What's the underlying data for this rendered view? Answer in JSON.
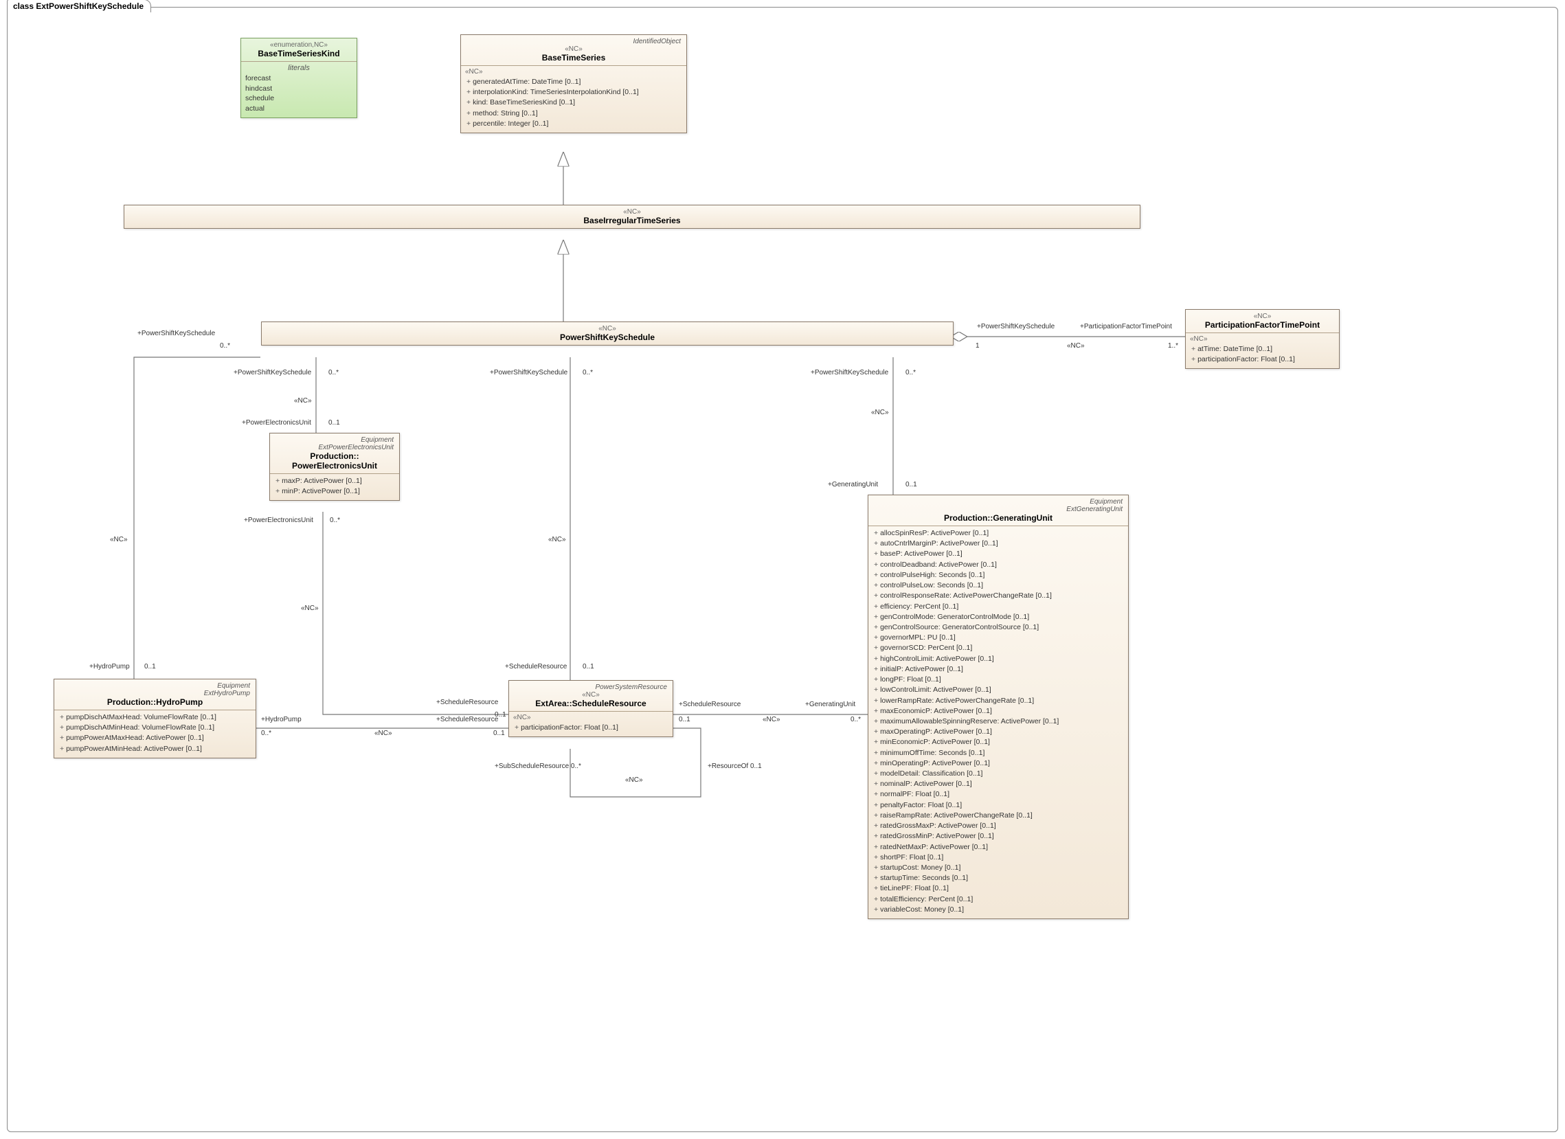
{
  "frame": {
    "title_prefix": "class",
    "title": "ExtPowerShiftKeySchedule"
  },
  "enum_BaseTimeSeriesKind": {
    "stereo": "«enumeration,NC»",
    "name": "BaseTimeSeriesKind",
    "literals_label": "literals",
    "l0": "forecast",
    "l1": "hindcast",
    "l2": "schedule",
    "l3": "actual"
  },
  "BaseTimeSeries": {
    "parent": "IdentifiedObject",
    "stereo": "«NC»",
    "name": "BaseTimeSeries",
    "sec_stereo": "«NC»",
    "a0": "generatedAtTime: DateTime [0..1]",
    "a1": "interpolationKind: TimeSeriesInterpolationKind [0..1]",
    "a2": "kind: BaseTimeSeriesKind [0..1]",
    "a3": "method: String [0..1]",
    "a4": "percentile: Integer [0..1]"
  },
  "BaseIrregularTimeSeries": {
    "stereo": "«NC»",
    "name": "BaseIrregularTimeSeries"
  },
  "PowerShiftKeySchedule": {
    "stereo": "«NC»",
    "name": "PowerShiftKeySchedule"
  },
  "ParticipationFactorTimePoint": {
    "stereo": "«NC»",
    "name": "ParticipationFactorTimePoint",
    "sec_stereo": "«NC»",
    "a0": "atTime: DateTime [0..1]",
    "a1": "participationFactor: Float [0..1]"
  },
  "PowerElectronicsUnit": {
    "parent1": "Equipment",
    "parent2": "ExtPowerElectronicsUnit",
    "stereo": "Production::",
    "name": "PowerElectronicsUnit",
    "a0": "maxP: ActivePower [0..1]",
    "a1": "minP: ActivePower [0..1]"
  },
  "HydroPump": {
    "parent1": "Equipment",
    "parent2": "ExtHydroPump",
    "stereo": "Production::",
    "name": "HydroPump",
    "a0": "pumpDischAtMaxHead: VolumeFlowRate [0..1]",
    "a1": "pumpDischAtMinHead: VolumeFlowRate [0..1]",
    "a2": "pumpPowerAtMaxHead: ActivePower [0..1]",
    "a3": "pumpPowerAtMinHead: ActivePower [0..1]"
  },
  "ScheduleResource": {
    "parent": "PowerSystemResource",
    "stereo": "«NC»",
    "qname_prefix": "ExtArea::",
    "name": "ScheduleResource",
    "sec_stereo": "«NC»",
    "a0": "participationFactor: Float [0..1]"
  },
  "GeneratingUnit": {
    "parent1": "Equipment",
    "parent2": "ExtGeneratingUnit",
    "qname_prefix": "Production::",
    "name": "GeneratingUnit",
    "a0": "allocSpinResP: ActivePower [0..1]",
    "a1": "autoCntrlMarginP: ActivePower [0..1]",
    "a2": "baseP: ActivePower [0..1]",
    "a3": "controlDeadband: ActivePower [0..1]",
    "a4": "controlPulseHigh: Seconds [0..1]",
    "a5": "controlPulseLow: Seconds [0..1]",
    "a6": "controlResponseRate: ActivePowerChangeRate [0..1]",
    "a7": "efficiency: PerCent [0..1]",
    "a8": "genControlMode: GeneratorControlMode [0..1]",
    "a9": "genControlSource: GeneratorControlSource [0..1]",
    "a10": "governorMPL: PU [0..1]",
    "a11": "governorSCD: PerCent [0..1]",
    "a12": "highControlLimit: ActivePower [0..1]",
    "a13": "initialP: ActivePower [0..1]",
    "a14": "longPF: Float [0..1]",
    "a15": "lowControlLimit: ActivePower [0..1]",
    "a16": "lowerRampRate: ActivePowerChangeRate [0..1]",
    "a17": "maxEconomicP: ActivePower [0..1]",
    "a18": "maximumAllowableSpinningReserve: ActivePower [0..1]",
    "a19": "maxOperatingP: ActivePower [0..1]",
    "a20": "minEconomicP: ActivePower [0..1]",
    "a21": "minimumOffTime: Seconds [0..1]",
    "a22": "minOperatingP: ActivePower [0..1]",
    "a23": "modelDetail: Classification [0..1]",
    "a24": "nominalP: ActivePower [0..1]",
    "a25": "normalPF: Float [0..1]",
    "a26": "penaltyFactor: Float [0..1]",
    "a27": "raiseRampRate: ActivePowerChangeRate [0..1]",
    "a28": "ratedGrossMaxP: ActivePower [0..1]",
    "a29": "ratedGrossMinP: ActivePower [0..1]",
    "a30": "ratedNetMaxP: ActivePower [0..1]",
    "a31": "shortPF: Float [0..1]",
    "a32": "startupCost: Money [0..1]",
    "a33": "startupTime: Seconds [0..1]",
    "a34": "tieLinePF: Float [0..1]",
    "a35": "totalEfficiency: PerCent [0..1]",
    "a36": "variableCost: Money [0..1]"
  },
  "labels": {
    "psks": "+PowerShiftKeySchedule",
    "peu": "+PowerElectronicsUnit",
    "hp": "+HydroPump",
    "gu": "+GeneratingUnit",
    "sr": "+ScheduleResource",
    "ssr": "+SubScheduleResource",
    "ro": "+ResourceOf",
    "pftp": "+ParticipationFactorTimePoint",
    "nc": "«NC»",
    "m0s": "0..*",
    "m01": "0..1",
    "m1": "1",
    "m1s": "1..*",
    "ssr_full": "+SubScheduleResource 0..*",
    "ro_full": "+ResourceOf   0..1"
  }
}
